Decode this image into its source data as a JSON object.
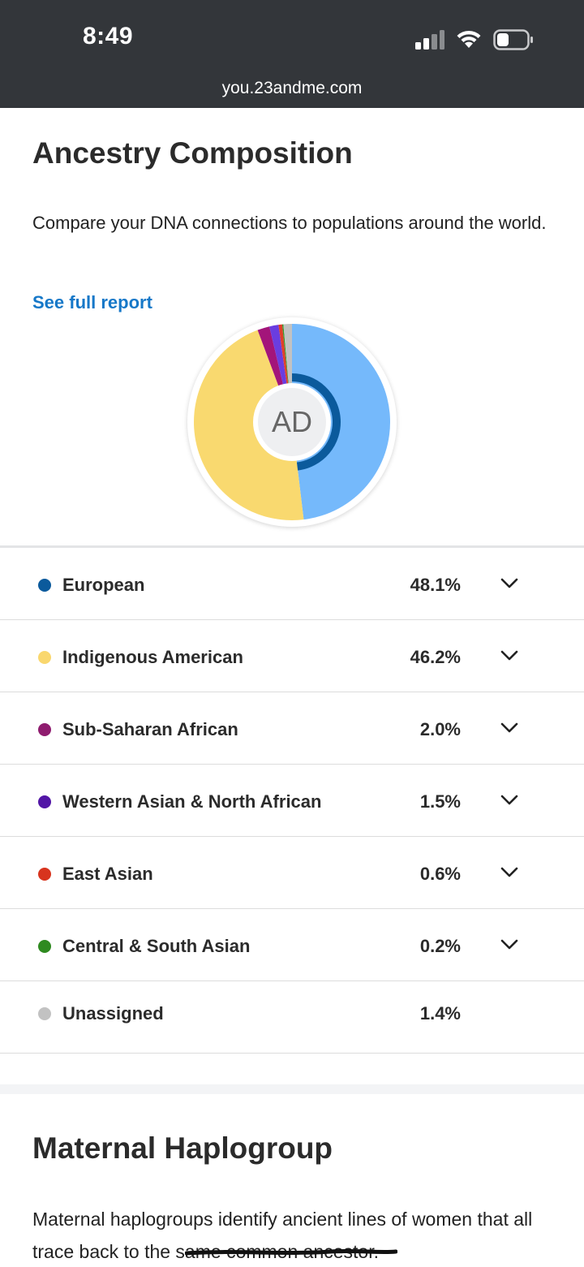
{
  "status_bar": {
    "time": "8:49",
    "url": "you.23andme.com",
    "icons": [
      "signal-icon",
      "wifi-icon",
      "battery-icon"
    ]
  },
  "ancestry": {
    "title": "Ancestry Composition",
    "description": "Compare your DNA connections to populations around the world.",
    "link_label": "See full report",
    "avatar_initials": "AD",
    "rows": [
      {
        "label": "European",
        "percent": "48.1%",
        "color": "#0b5a9c",
        "expandable": true
      },
      {
        "label": "Indigenous American",
        "percent": "46.2%",
        "color": "#f9d76e",
        "expandable": true
      },
      {
        "label": "Sub-Saharan African",
        "percent": "2.0%",
        "color": "#8f1c6f",
        "expandable": true
      },
      {
        "label": "Western Asian & North African",
        "percent": "1.5%",
        "color": "#5216a6",
        "expandable": true
      },
      {
        "label": "East Asian",
        "percent": "0.6%",
        "color": "#d8341e",
        "expandable": true
      },
      {
        "label": "Central & South Asian",
        "percent": "0.2%",
        "color": "#2f8a20",
        "expandable": true
      },
      {
        "label": "Unassigned",
        "percent": "1.4%",
        "color": "#c2c2c2",
        "expandable": false
      }
    ]
  },
  "chart_data": {
    "type": "pie",
    "categories": [
      "European",
      "Indigenous American",
      "Sub-Saharan African",
      "Western Asian & North African",
      "East Asian",
      "Central & South Asian",
      "Unassigned"
    ],
    "values": [
      48.1,
      46.2,
      2.0,
      1.5,
      0.6,
      0.2,
      1.4
    ],
    "colors": [
      "#75b9fb",
      "#f9d96f",
      "#a3157a",
      "#6a3de0",
      "#e0402a",
      "#3a9a2a",
      "#c2c2c2"
    ],
    "inner_ring_color": "#0b5a9c"
  },
  "maternal": {
    "title": "Maternal Haplogroup",
    "description": "Maternal haplogroups identify ancient lines of women that all trace back to the same common ancestor."
  }
}
